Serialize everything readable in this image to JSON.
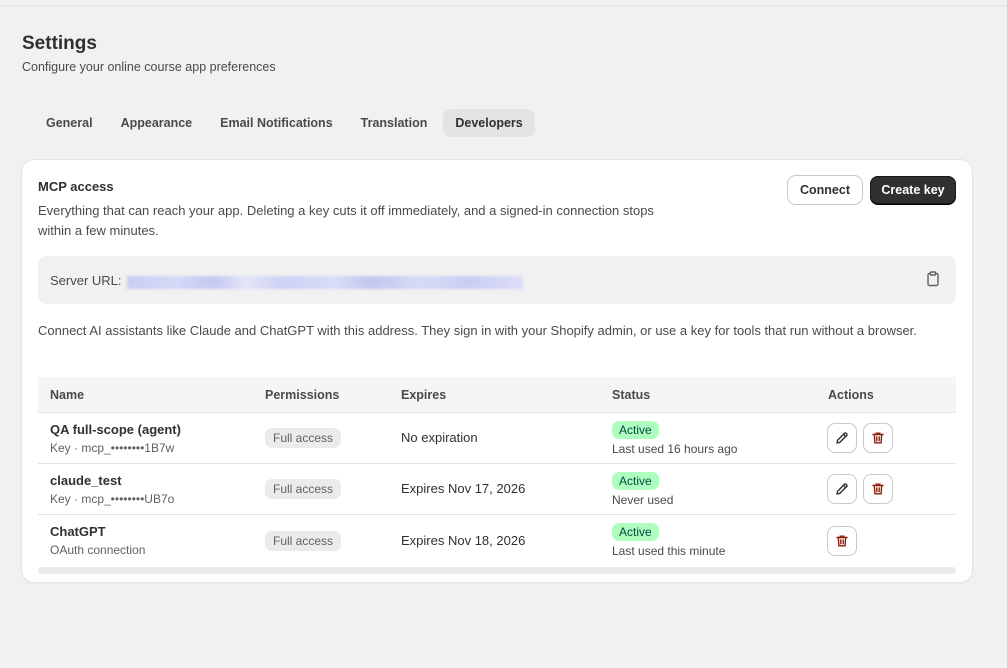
{
  "header": {
    "title": "Settings",
    "subtitle": "Configure your online course app preferences"
  },
  "tabs": [
    {
      "label": "General",
      "active": false
    },
    {
      "label": "Appearance",
      "active": false
    },
    {
      "label": "Email Notifications",
      "active": false
    },
    {
      "label": "Translation",
      "active": false
    },
    {
      "label": "Developers",
      "active": true
    }
  ],
  "mcp": {
    "title": "MCP access",
    "description": "Everything that can reach your app. Deleting a key cuts it off immediately, and a signed-in connection stops within a few minutes.",
    "connect_label": "Connect",
    "create_key_label": "Create key",
    "server_url_label": "Server URL:",
    "help_text": "Connect AI assistants like Claude and ChatGPT with this address. They sign in with your Shopify admin, or use a key for tools that run without a browser."
  },
  "table": {
    "headers": {
      "name": "Name",
      "permissions": "Permissions",
      "expires": "Expires",
      "status": "Status",
      "actions": "Actions"
    },
    "rows": [
      {
        "name": "QA full-scope (agent)",
        "sub": "Key · mcp_••••••••1B7w",
        "permission": "Full access",
        "expires": "No expiration",
        "status": "Active",
        "status_sub": "Last used 16 hours ago",
        "editable": true
      },
      {
        "name": "claude_test",
        "sub": "Key · mcp_••••••••UB7o",
        "permission": "Full access",
        "expires": "Expires Nov 17, 2026",
        "status": "Active",
        "status_sub": "Never used",
        "editable": true
      },
      {
        "name": "ChatGPT",
        "sub": "OAuth connection",
        "permission": "Full access",
        "expires": "Expires Nov 18, 2026",
        "status": "Active",
        "status_sub": "Last used this minute",
        "editable": false
      }
    ]
  },
  "colors": {
    "active_badge_bg": "#affebf",
    "active_badge_text": "#014b40",
    "delete_icon": "#8e1f0b",
    "primary_button": "#303030"
  },
  "icons": {
    "copy": "clipboard-icon",
    "edit": "pencil-icon",
    "delete": "trash-icon"
  }
}
